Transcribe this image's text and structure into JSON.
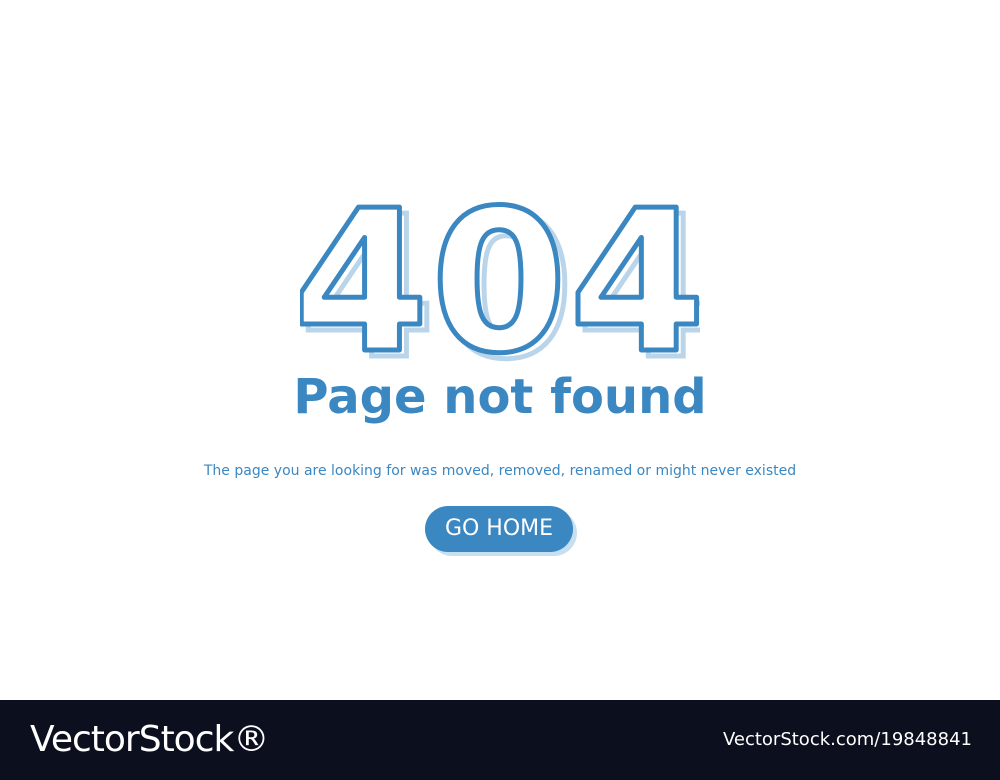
{
  "error": {
    "code": "404",
    "title": "Page not found",
    "message": "The page you are looking for was moved, removed, renamed or might never existed"
  },
  "actions": {
    "home_label": "GO HOME"
  },
  "watermark": {
    "brand": "VectorStock®",
    "id": "VectorStock.com/19848841"
  },
  "colors": {
    "accent": "#3a87c2",
    "background": "#ffffff",
    "watermark_bar": "#0b0f1e"
  }
}
